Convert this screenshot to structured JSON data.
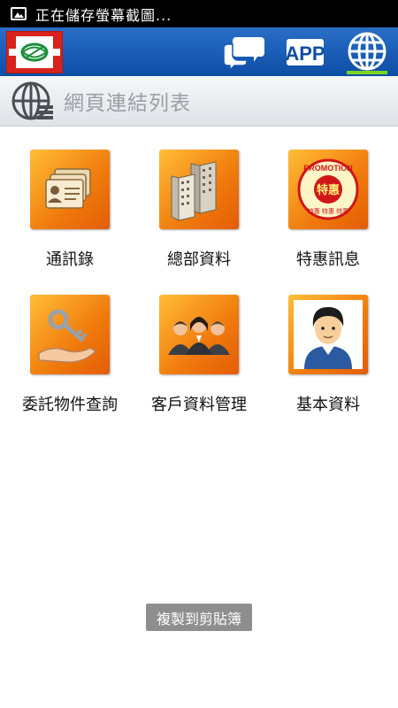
{
  "status_bar": {
    "text": "正在儲存螢幕截圖...",
    "icon": "image-icon"
  },
  "app_bar": {
    "nav": [
      {
        "name": "chat",
        "icon": "chat-bubbles-icon"
      },
      {
        "name": "app",
        "label": "APP",
        "icon": "app-icon"
      },
      {
        "name": "web",
        "icon": "globe-icon",
        "active": true
      }
    ],
    "accent_color": "#7ed321"
  },
  "section": {
    "title": "網頁連結列表",
    "icon": "globe-list-icon"
  },
  "tiles": [
    {
      "label": "通訊錄",
      "icon": "contact-cards-icon"
    },
    {
      "label": "總部資料",
      "icon": "buildings-icon"
    },
    {
      "label": "特惠訊息",
      "icon": "promotion-badge-icon",
      "badge_top": "PROMOTION",
      "badge_center": "特惠",
      "badge_bottom": "特惠 特惠 特惠"
    },
    {
      "label": "委託物件查詢",
      "icon": "key-hand-icon"
    },
    {
      "label": "客戶資料管理",
      "icon": "customers-group-icon"
    },
    {
      "label": "基本資料",
      "icon": "person-profile-icon"
    }
  ],
  "toast": {
    "text": "複製到剪貼簿"
  }
}
